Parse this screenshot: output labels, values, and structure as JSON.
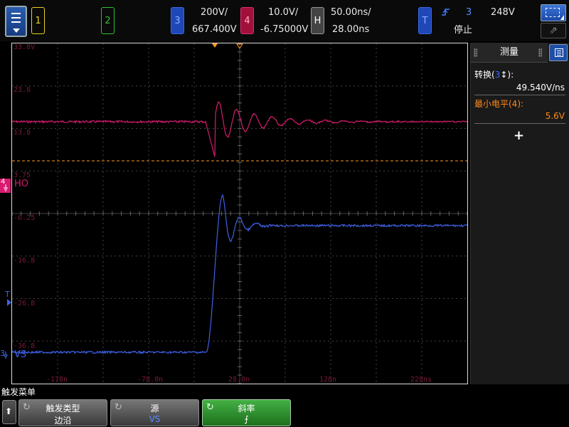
{
  "topbar": {
    "ch1": "1",
    "ch2": "2",
    "ch3": {
      "label": "3",
      "scale": "200V/",
      "offset": "667.400V"
    },
    "ch4": {
      "label": "4",
      "scale": "10.0V/",
      "offset": "-6.75000V"
    },
    "horizontal": {
      "label": "H",
      "scale": "50.00ns/",
      "delay": "28.00ns"
    },
    "trigger": {
      "label": "T",
      "source": "3",
      "level": "248V",
      "status": "停止"
    },
    "zoom_glyph": "⇗"
  },
  "graticule": {
    "ch4_tag": "4",
    "ch4_name": "HO",
    "ch3_tag": "3",
    "ch3_name": "VS",
    "trig_marker": "T",
    "ylabels": [
      "33.8V",
      "23.8",
      "13.8",
      "3.75",
      "-6.25",
      "-16.8",
      "-26.8",
      "-36.8"
    ],
    "xlabels": [
      "-178n",
      "-78.0n",
      "28.0n",
      "128n",
      "228ns"
    ],
    "colors": {
      "ch3": "#3f61e8",
      "ch4": "#d81b6f",
      "label": "#7a1a3a",
      "cursor": "#ff9a20"
    }
  },
  "panel": {
    "title": "测量",
    "m1_label_pre": "转换(",
    "m1_label_ch": "3",
    "m1_label_post": "↕):",
    "m1_value": "49.540V/ns",
    "m2_label": "最小电平(4):",
    "m2_value": "5.6V",
    "add": "+"
  },
  "softkeys": {
    "menu_title": "触发菜单",
    "k1": {
      "top": "触发类型",
      "bottom": "边沿"
    },
    "k2": {
      "top": "源",
      "bottom": "VS"
    },
    "k3": {
      "top": "斜率",
      "bottom": "⨍"
    }
  }
}
